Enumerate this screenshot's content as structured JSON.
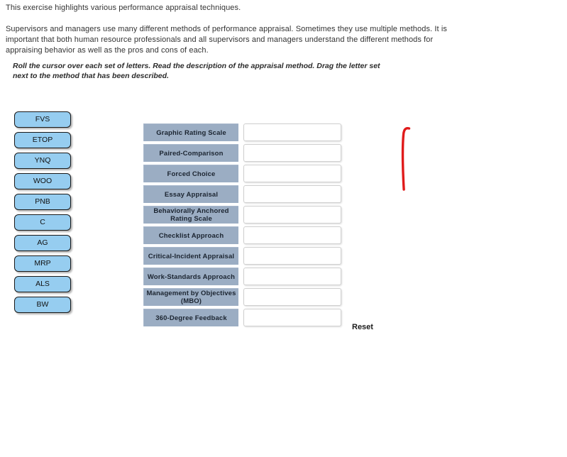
{
  "intro": {
    "lead": "This exercise highlights various performance appraisal techniques.",
    "body": "Supervisors and managers use many different methods of performance appraisal. Sometimes they use multiple methods. It is important that both human resource professionals and all supervisors and managers understand the different methods for appraising behavior as well as the pros and cons of each.",
    "instructions": "Roll the cursor over each set of letters. Read the description of the appraisal method.  Drag the letter set next to the method that has been described."
  },
  "letter_tiles": [
    {
      "label": "FVS"
    },
    {
      "label": "ETOP"
    },
    {
      "label": "YNQ"
    },
    {
      "label": "WOO"
    },
    {
      "label": "PNB"
    },
    {
      "label": "C"
    },
    {
      "label": "AG"
    },
    {
      "label": "MRP"
    },
    {
      "label": "ALS"
    },
    {
      "label": "BW"
    }
  ],
  "methods": [
    {
      "name": "Graphic Rating Scale",
      "answer": ""
    },
    {
      "name": "Paired-Comparison",
      "answer": ""
    },
    {
      "name": "Forced Choice",
      "answer": ""
    },
    {
      "name": "Essay Appraisal",
      "answer": ""
    },
    {
      "name": "Behaviorally Anchored Rating Scale",
      "answer": ""
    },
    {
      "name": "Checklist Approach",
      "answer": ""
    },
    {
      "name": "Critical-Incident Appraisal",
      "answer": ""
    },
    {
      "name": "Work-Standards Approach",
      "answer": ""
    },
    {
      "name": "Management by Objectives (MBO)",
      "answer": ""
    },
    {
      "name": "360-Degree Feedback",
      "answer": ""
    }
  ],
  "controls": {
    "reset_label": "Reset"
  },
  "annotation": {
    "shape": "red-vertical-stroke",
    "color": "#e01b1b"
  },
  "colors": {
    "tile_fill": "#96cdf0",
    "tile_border": "#191919",
    "method_label_fill": "#9badc3",
    "method_label_text": "#1b2430",
    "drop_fill": "#ffffff",
    "drop_border": "#cfcfcf",
    "body_text": "#333333",
    "annotation_red": "#e01b1b"
  }
}
